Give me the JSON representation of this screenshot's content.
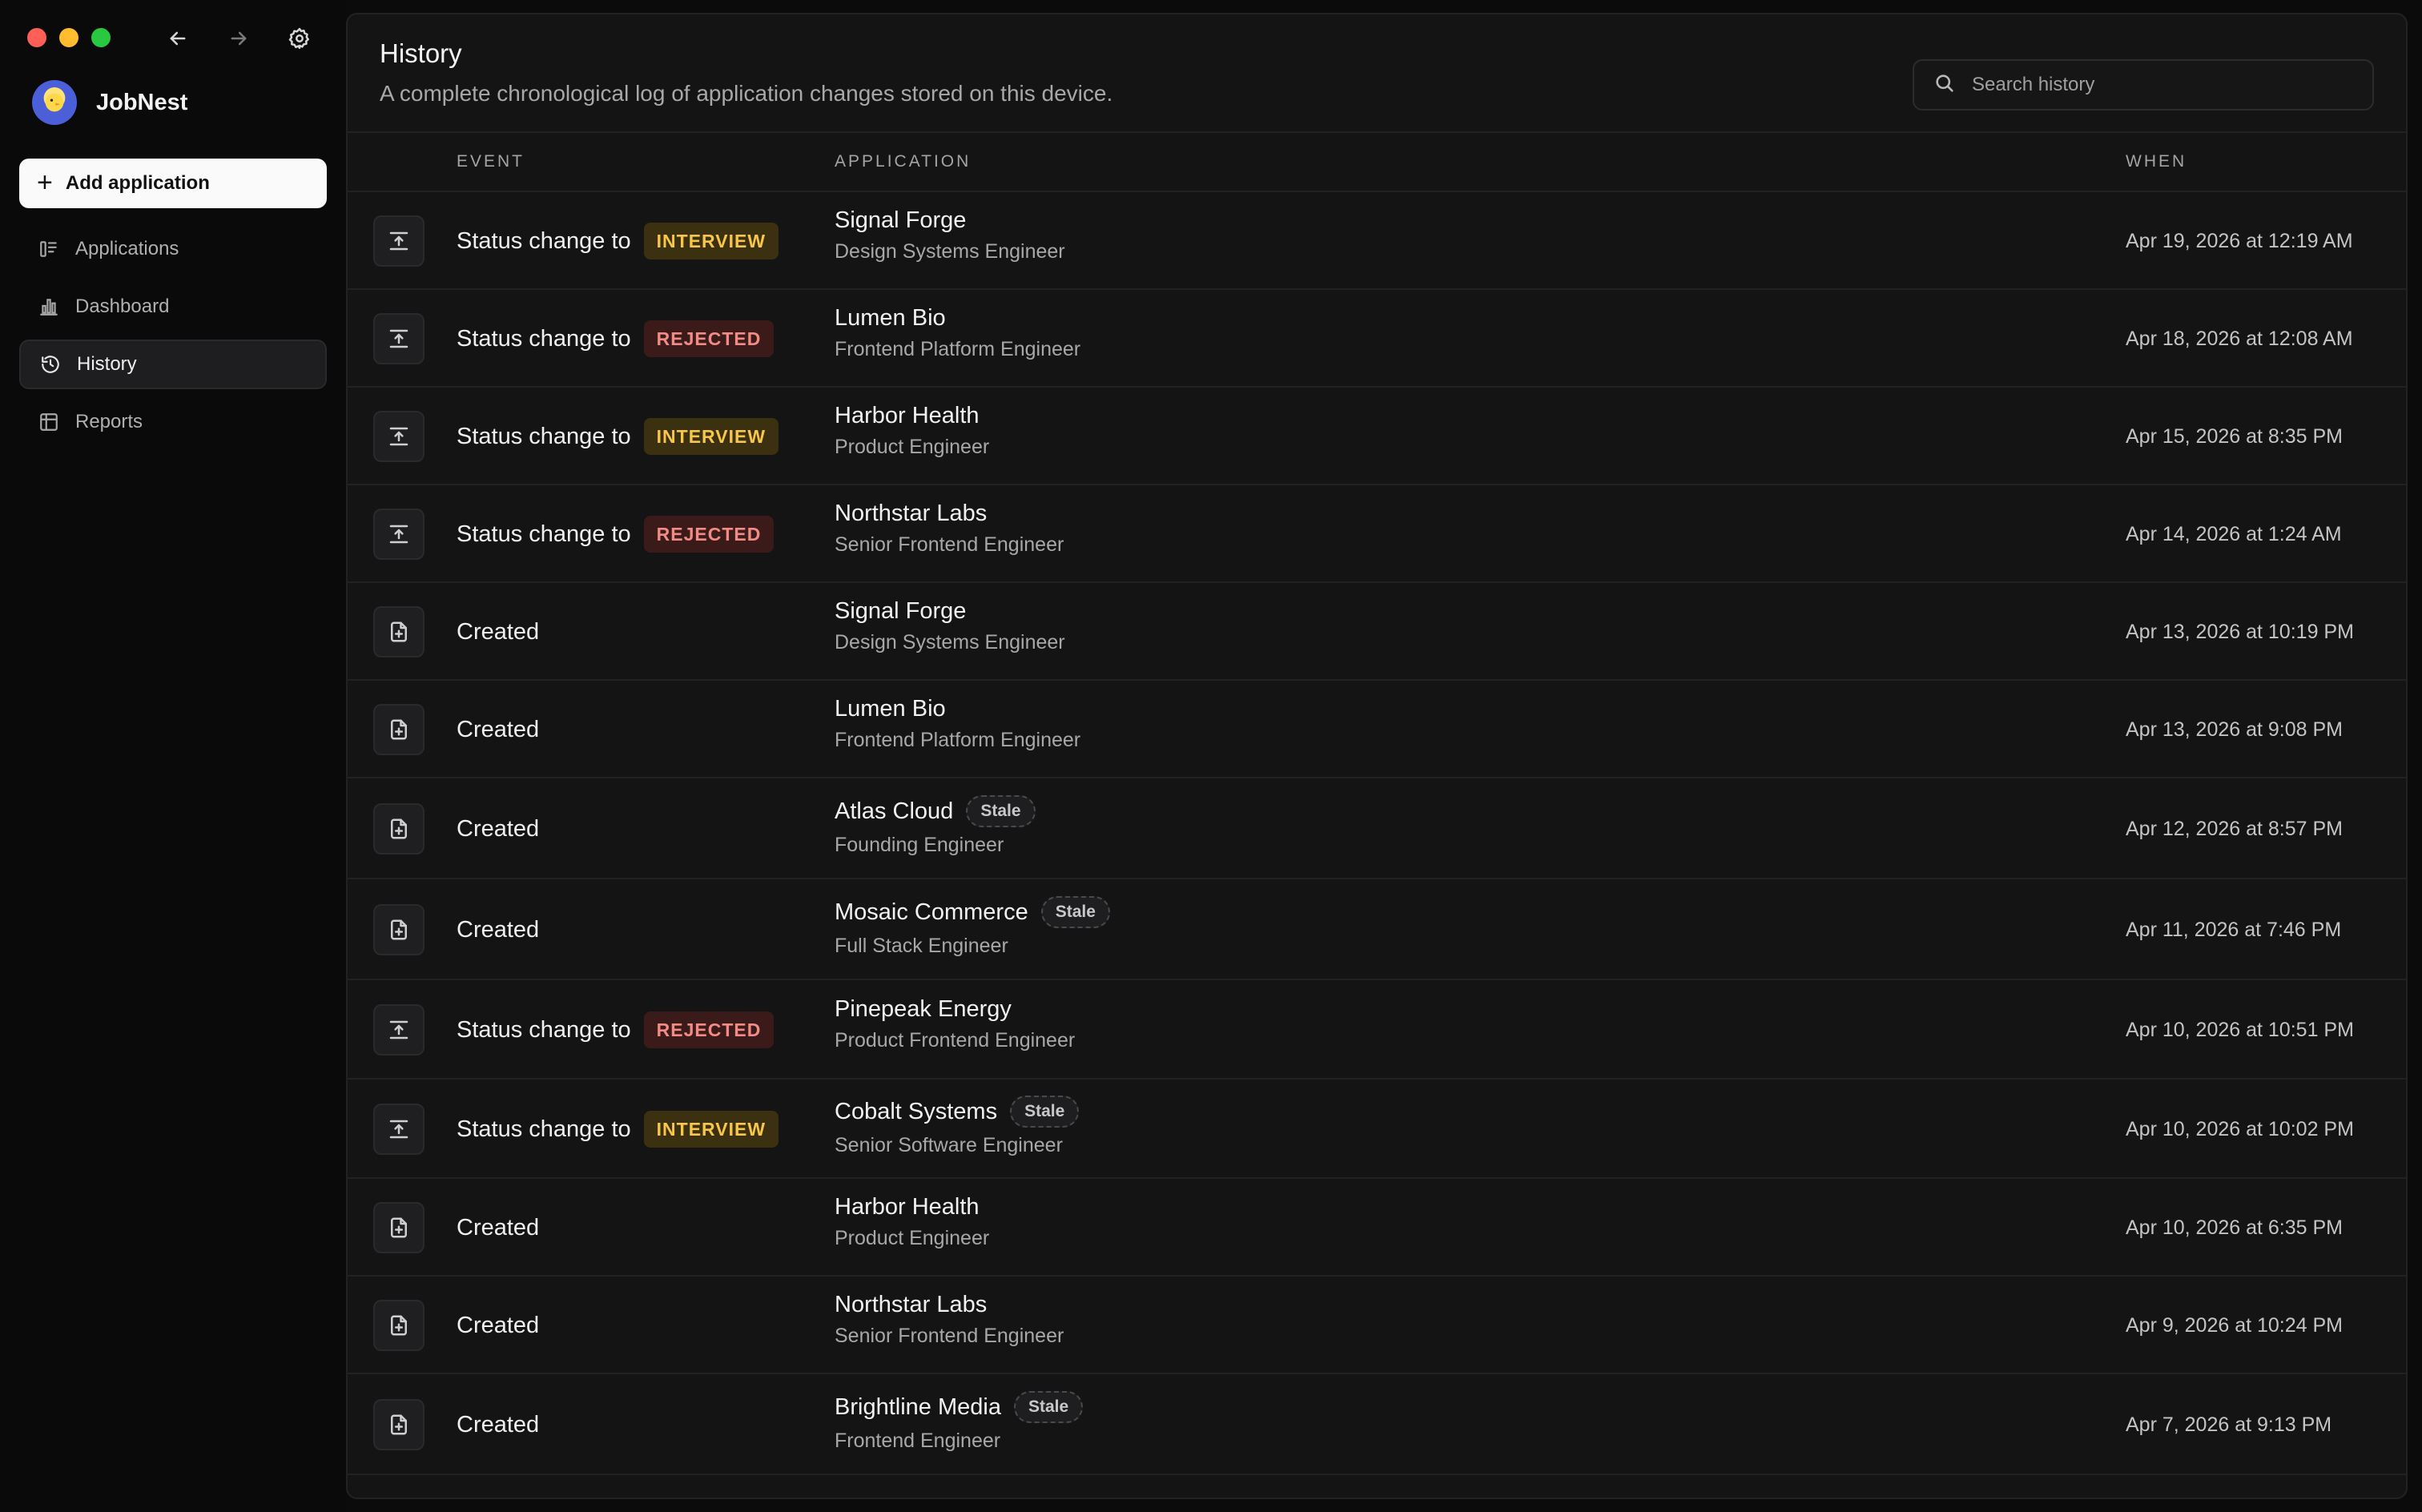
{
  "window": {
    "back_icon": "arrow-left-icon",
    "forward_icon": "arrow-right-icon",
    "settings_icon": "gear-icon"
  },
  "sidebar": {
    "brand": "JobNest",
    "add_button": "Add application",
    "items": [
      {
        "label": "Applications",
        "icon": "kanban-icon",
        "active": false
      },
      {
        "label": "Dashboard",
        "icon": "bar-chart-icon",
        "active": false
      },
      {
        "label": "History",
        "icon": "history-icon",
        "active": true
      },
      {
        "label": "Reports",
        "icon": "table-icon",
        "active": false
      }
    ]
  },
  "header": {
    "title": "History",
    "subtitle": "A complete chronological log of application changes stored on this device.",
    "search_placeholder": "Search history"
  },
  "table": {
    "columns": {
      "event": "EVENT",
      "application": "APPLICATION",
      "when": "WHEN"
    },
    "rows": [
      {
        "type": "status",
        "event": "Status change to",
        "tag": "INTERVIEW",
        "company": "Signal Forge",
        "role": "Design Systems Engineer",
        "stale": "",
        "when": "Apr 19, 2026 at 12:19 AM"
      },
      {
        "type": "status",
        "event": "Status change to",
        "tag": "REJECTED",
        "company": "Lumen Bio",
        "role": "Frontend Platform Engineer",
        "stale": "",
        "when": "Apr 18, 2026 at 12:08 AM"
      },
      {
        "type": "status",
        "event": "Status change to",
        "tag": "INTERVIEW",
        "company": "Harbor Health",
        "role": "Product Engineer",
        "stale": "",
        "when": "Apr 15, 2026 at 8:35 PM"
      },
      {
        "type": "status",
        "event": "Status change to",
        "tag": "REJECTED",
        "company": "Northstar Labs",
        "role": "Senior Frontend Engineer",
        "stale": "",
        "when": "Apr 14, 2026 at 1:24 AM"
      },
      {
        "type": "created",
        "event": "Created",
        "tag": "",
        "company": "Signal Forge",
        "role": "Design Systems Engineer",
        "stale": "",
        "when": "Apr 13, 2026 at 10:19 PM"
      },
      {
        "type": "created",
        "event": "Created",
        "tag": "",
        "company": "Lumen Bio",
        "role": "Frontend Platform Engineer",
        "stale": "",
        "when": "Apr 13, 2026 at 9:08 PM"
      },
      {
        "type": "created",
        "event": "Created",
        "tag": "",
        "company": "Atlas Cloud",
        "role": "Founding Engineer",
        "stale": "Stale",
        "when": "Apr 12, 2026 at 8:57 PM"
      },
      {
        "type": "created",
        "event": "Created",
        "tag": "",
        "company": "Mosaic Commerce",
        "role": "Full Stack Engineer",
        "stale": "Stale",
        "when": "Apr 11, 2026 at 7:46 PM"
      },
      {
        "type": "status",
        "event": "Status change to",
        "tag": "REJECTED",
        "company": "Pinepeak Energy",
        "role": "Product Frontend Engineer",
        "stale": "",
        "when": "Apr 10, 2026 at 10:51 PM"
      },
      {
        "type": "status",
        "event": "Status change to",
        "tag": "INTERVIEW",
        "company": "Cobalt Systems",
        "role": "Senior Software Engineer",
        "stale": "Stale",
        "when": "Apr 10, 2026 at 10:02 PM"
      },
      {
        "type": "created",
        "event": "Created",
        "tag": "",
        "company": "Harbor Health",
        "role": "Product Engineer",
        "stale": "",
        "when": "Apr 10, 2026 at 6:35 PM"
      },
      {
        "type": "created",
        "event": "Created",
        "tag": "",
        "company": "Northstar Labs",
        "role": "Senior Frontend Engineer",
        "stale": "",
        "when": "Apr 9, 2026 at 10:24 PM"
      },
      {
        "type": "created",
        "event": "Created",
        "tag": "",
        "company": "Brightline Media",
        "role": "Frontend Engineer",
        "stale": "Stale",
        "when": "Apr 7, 2026 at 9:13 PM"
      }
    ]
  }
}
